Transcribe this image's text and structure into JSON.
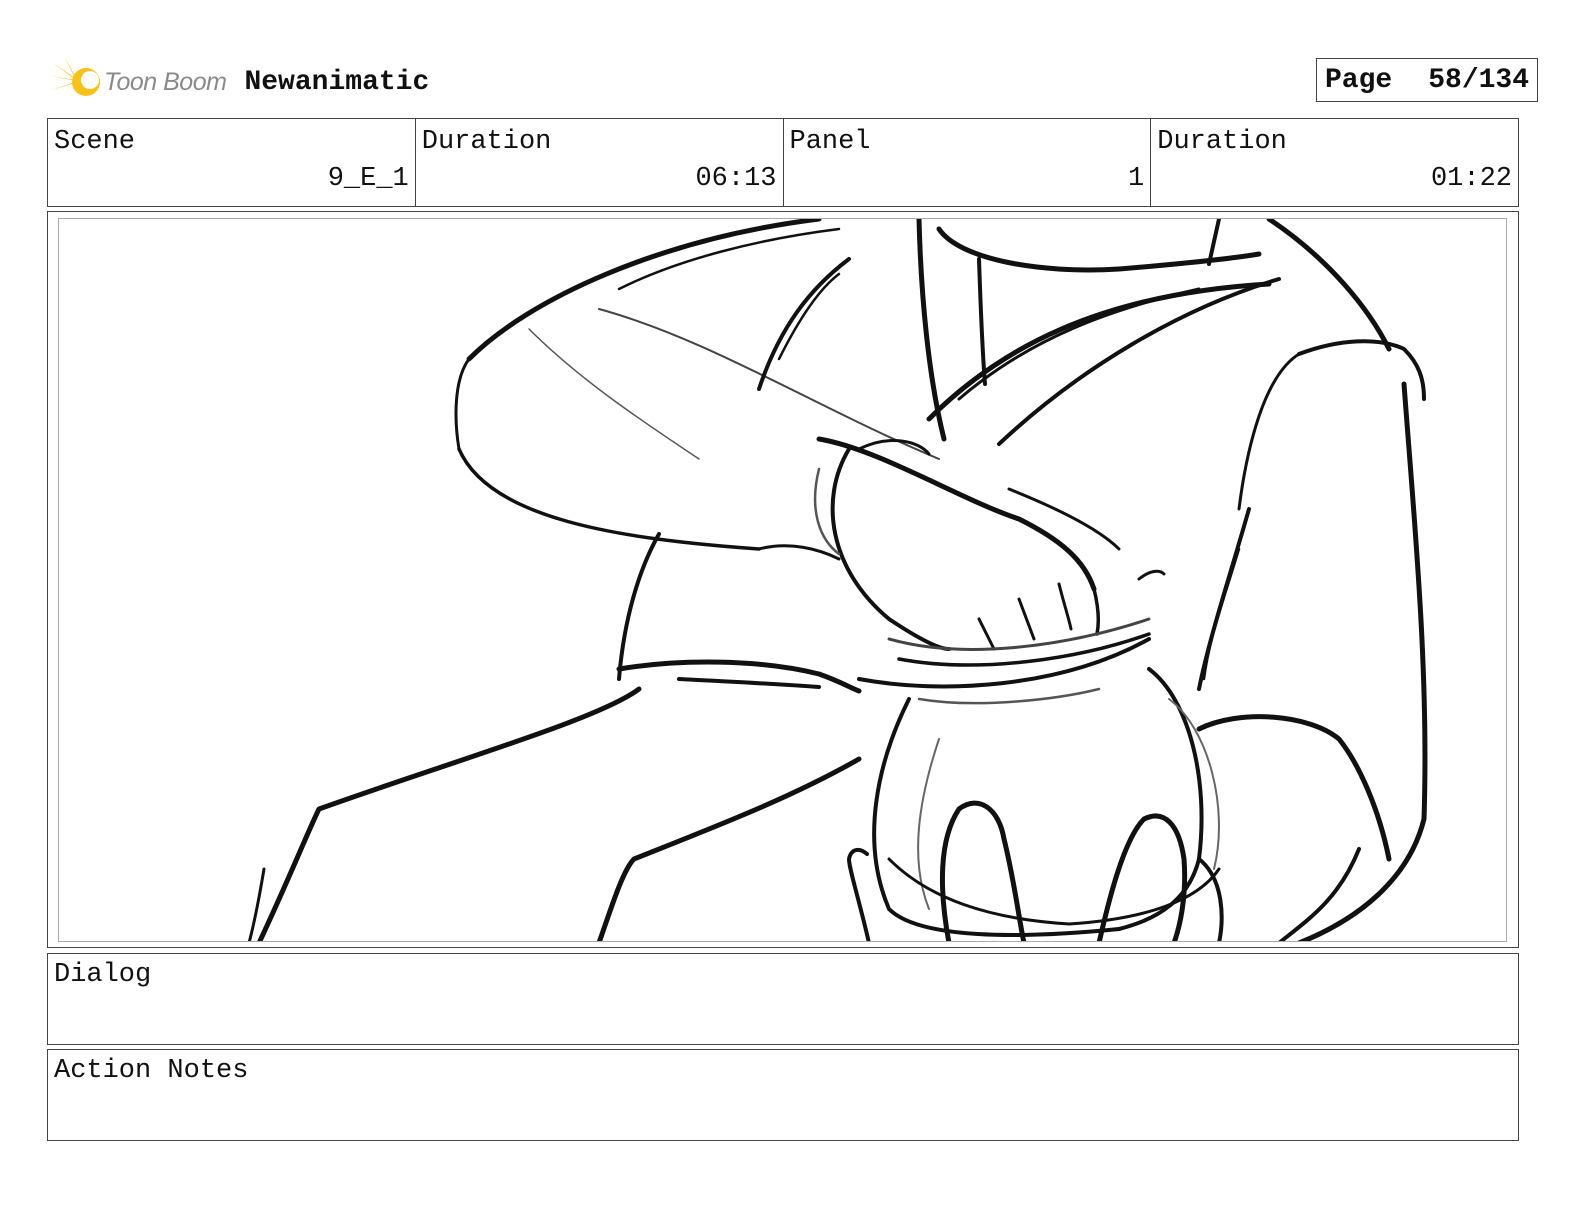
{
  "header": {
    "logo_text": "Toon Boom",
    "project_title": "Newanimatic",
    "page_label": "Page",
    "page_value": "58/134"
  },
  "info": {
    "scene_label": "Scene",
    "scene_value": "9_E_1",
    "scene_duration_label": "Duration",
    "scene_duration_value": "06:13",
    "panel_label": "Panel",
    "panel_value": "1",
    "panel_duration_label": "Duration",
    "panel_duration_value": "01:22"
  },
  "dialog": {
    "label": "Dialog",
    "text": ""
  },
  "action_notes": {
    "label": "Action Notes",
    "text": ""
  },
  "colors": {
    "logo_accent": "#f5b800",
    "border": "#444444"
  }
}
